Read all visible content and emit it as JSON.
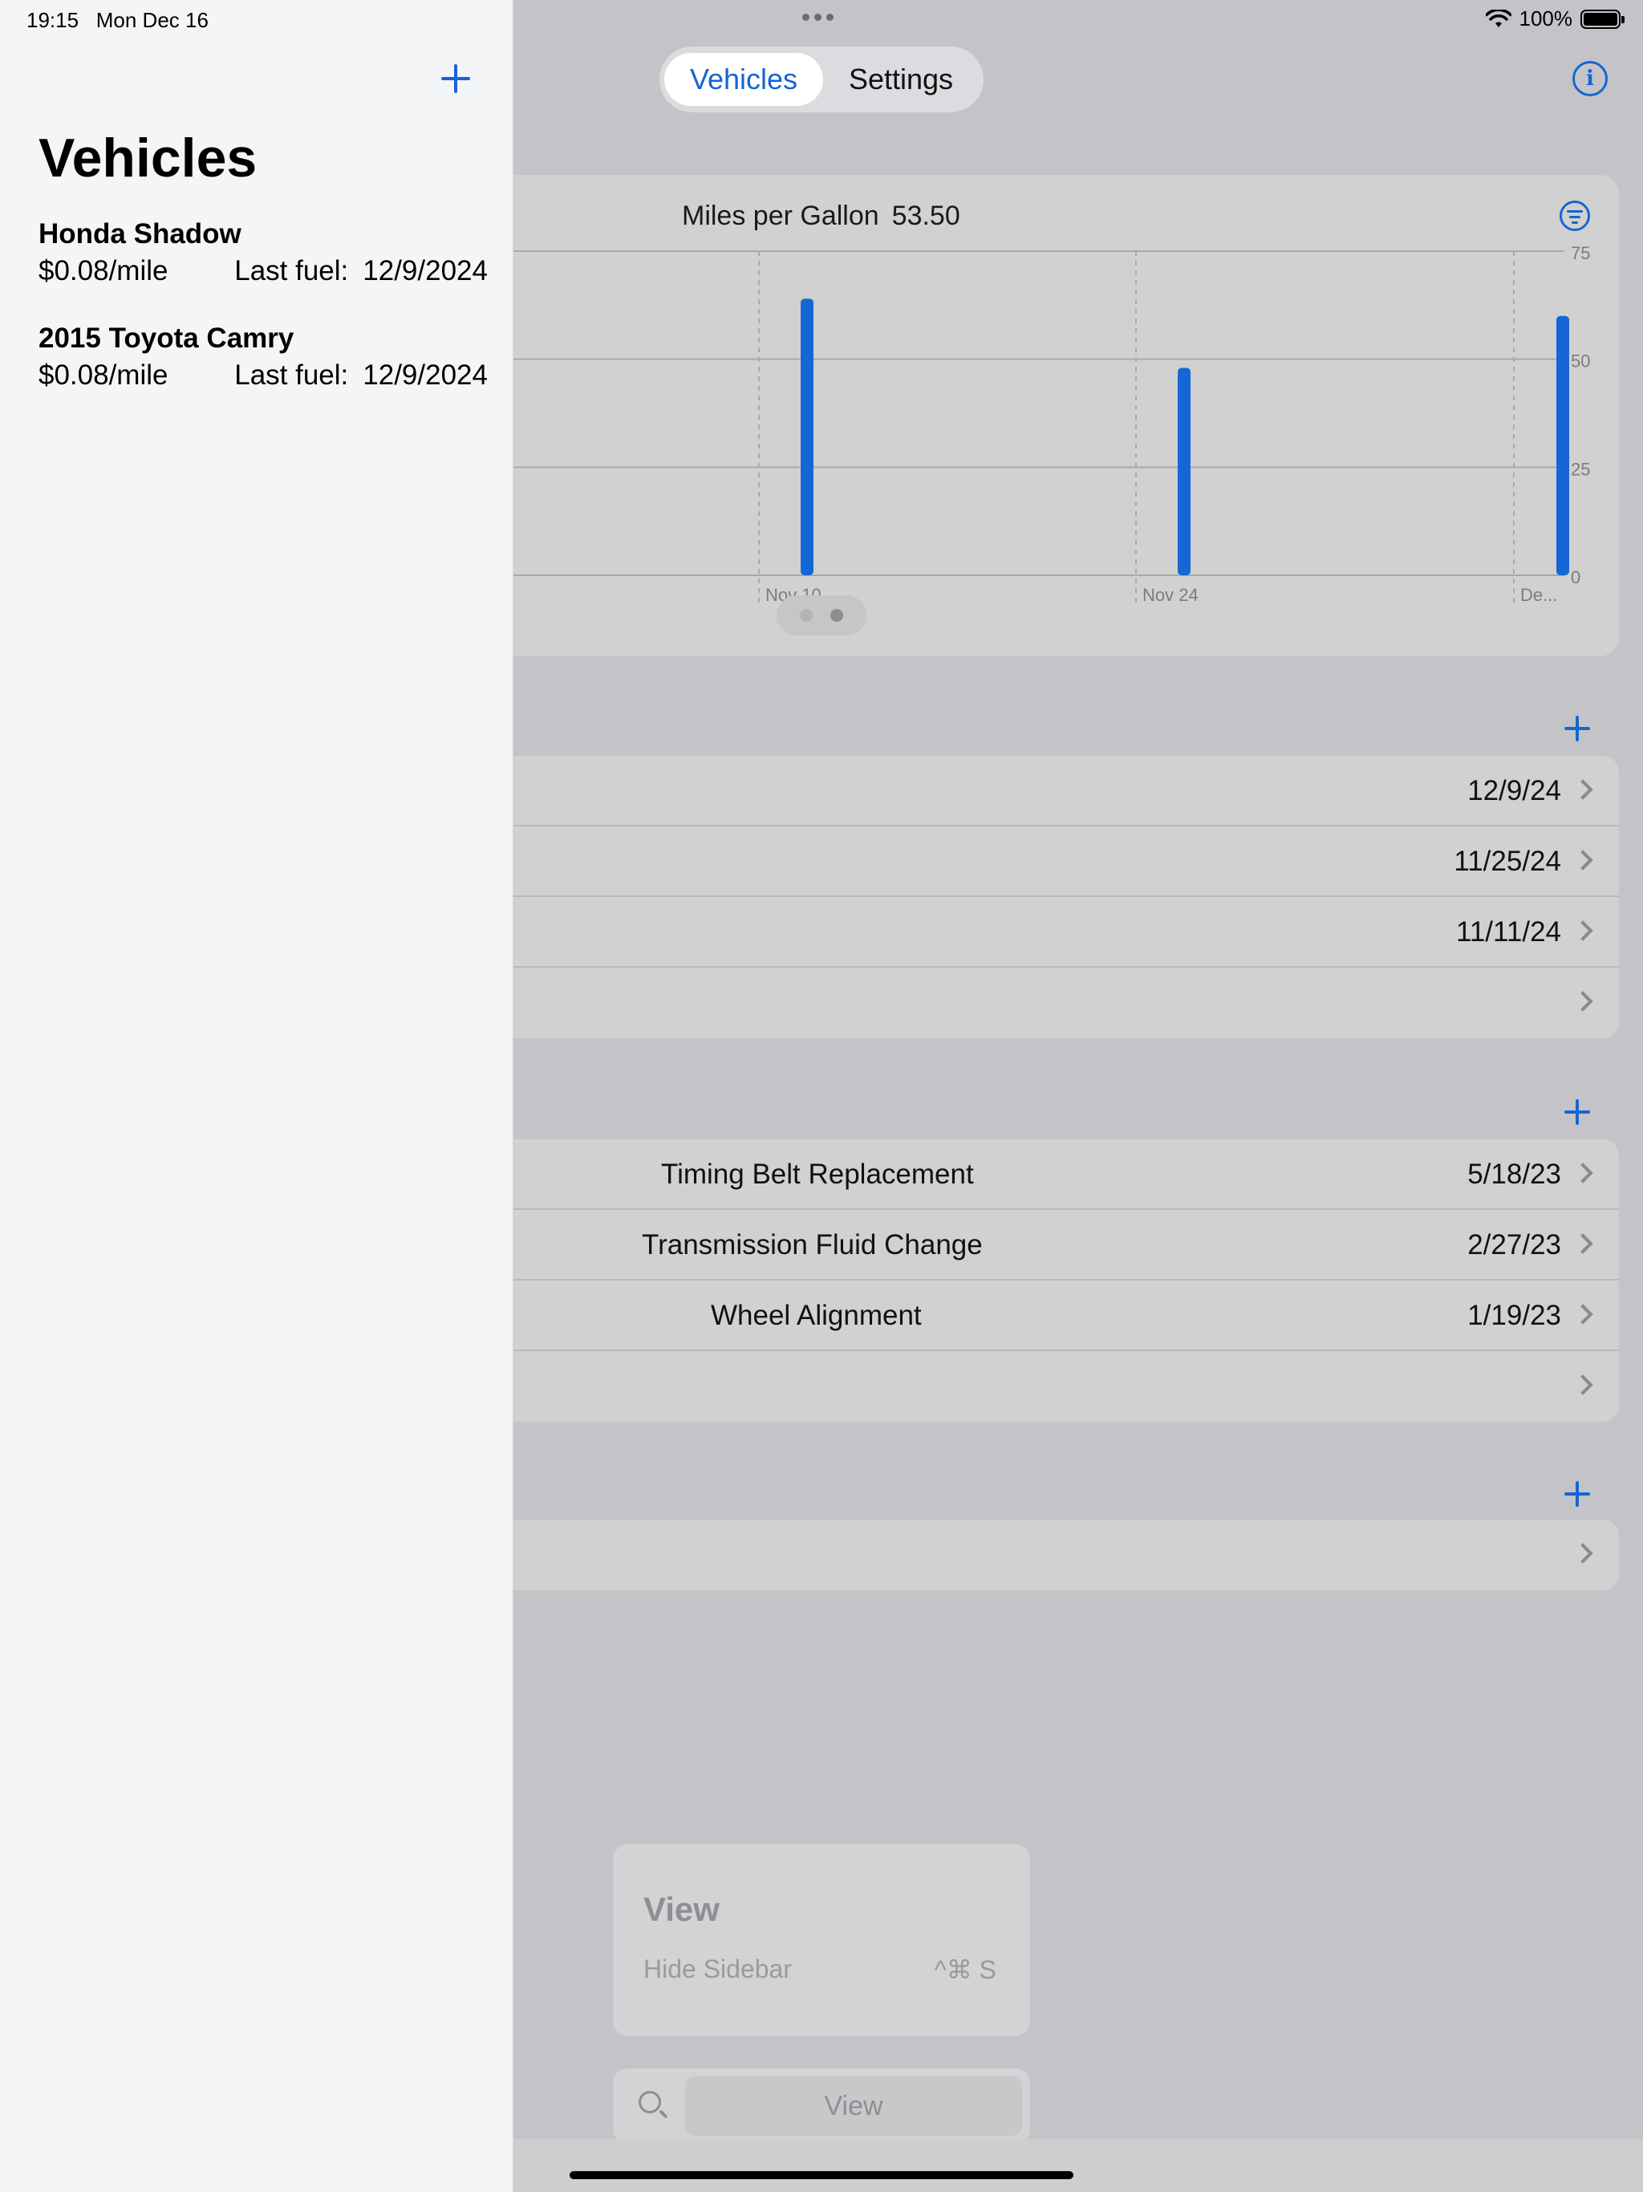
{
  "status_bar": {
    "time": "19:15",
    "date": "Mon Dec 16",
    "battery": "100%"
  },
  "segmented_control": {
    "active": "Vehicles",
    "inactive": "Settings"
  },
  "colors": {
    "accent": "#1466d2",
    "bar": "#1467d4"
  },
  "chart_card": {
    "title": "Miles per Gallon",
    "value": "53.50"
  },
  "chart_data": {
    "type": "bar",
    "categories": [
      "Nov 10",
      "Nov 24",
      "De..."
    ],
    "series": [
      {
        "values": [
          64,
          48,
          60
        ]
      }
    ],
    "ylim": [
      0,
      75
    ],
    "yticks": [
      "0",
      "25",
      "50",
      "75"
    ],
    "xticks": [
      "Nov 10",
      "Nov 24",
      "De..."
    ],
    "grid": true
  },
  "fuel_list": {
    "rows": [
      {
        "title": "",
        "date": "12/9/24"
      },
      {
        "title": "",
        "date": "11/25/24"
      },
      {
        "title": "",
        "date": "11/11/24"
      },
      {
        "title": "",
        "date": ""
      }
    ]
  },
  "maintenance_list": {
    "rows": [
      {
        "title": "Timing Belt Replacement",
        "date": "5/18/23"
      },
      {
        "title": "Transmission Fluid Change",
        "date": "2/27/23"
      },
      {
        "title": "Wheel Alignment",
        "date": "1/19/23"
      },
      {
        "title": "",
        "date": ""
      }
    ]
  },
  "third_list": {
    "rows": [
      {
        "title": "",
        "date": ""
      }
    ]
  },
  "view_menu": {
    "title": "View",
    "item": "Hide Sidebar",
    "shortcut": "^⌘ S",
    "search_label": "View"
  },
  "sidebar": {
    "title": "Vehicles",
    "vehicles": [
      {
        "name": "Honda Shadow",
        "cost": "$0.08/mile",
        "last_fuel_label": "Last fuel:",
        "last_fuel": "12/9/2024"
      },
      {
        "name": "2015 Toyota Camry",
        "cost": "$0.08/mile",
        "last_fuel_label": "Last fuel:",
        "last_fuel": "12/9/2024"
      }
    ]
  }
}
